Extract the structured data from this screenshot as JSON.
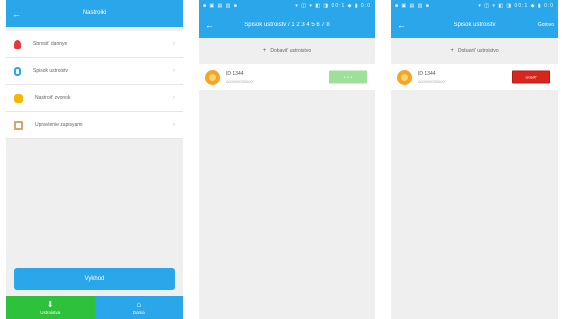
{
  "screen1": {
    "title": "Nastroiki",
    "back_icon": "arrow-left-icon",
    "menu": [
      {
        "label": "Sbrosit' dannye",
        "icon": "person-icon"
      },
      {
        "label": "Spisok ustroistv",
        "icon": "watch-icon"
      },
      {
        "label": "Nastroit' zvonok",
        "icon": "bell-icon"
      },
      {
        "label": "Upravlenie zapisyami",
        "icon": "box-icon"
      }
    ],
    "chevron": "›",
    "exit_label": "Vykhod",
    "tabs": [
      {
        "label": "Ustroistva",
        "icon": "download-icon",
        "glyph": "⬇"
      },
      {
        "label": "Doma",
        "icon": "home-icon",
        "glyph": "⌂"
      }
    ]
  },
  "screen2": {
    "status_left": "■ ▣ ▤ ▥ ■",
    "status_right": "▾ ◫ ▾ ◧ ◨ 00:1 ◆ ▮ 0:0",
    "title": "Spisok ustroistv / 1 2 3 4 5 6 7 8",
    "add_label": "Dobavit' ustroistvo",
    "device_name": "ID 1344",
    "device_sub": "000000000000",
    "button_label": "+ + +"
  },
  "screen3": {
    "status_left": "■ ▣ ▤ ▥ ■",
    "status_right": "▾ ◫ ▾ ◧ ◨ 00:1 ◆ ▮ 0:0",
    "title": "Spisok ustroistv",
    "right_action": "Gotovo",
    "add_label": "Dobavit' ustroistvo",
    "device_name": "ID 1344",
    "device_sub": "000000000000",
    "button_label": "Udalit'"
  },
  "colors": {
    "primary": "#2aa7ea",
    "tab_active": "#2ec13c",
    "delete": "#d9261c",
    "disabled_green": "#9ee09a"
  }
}
